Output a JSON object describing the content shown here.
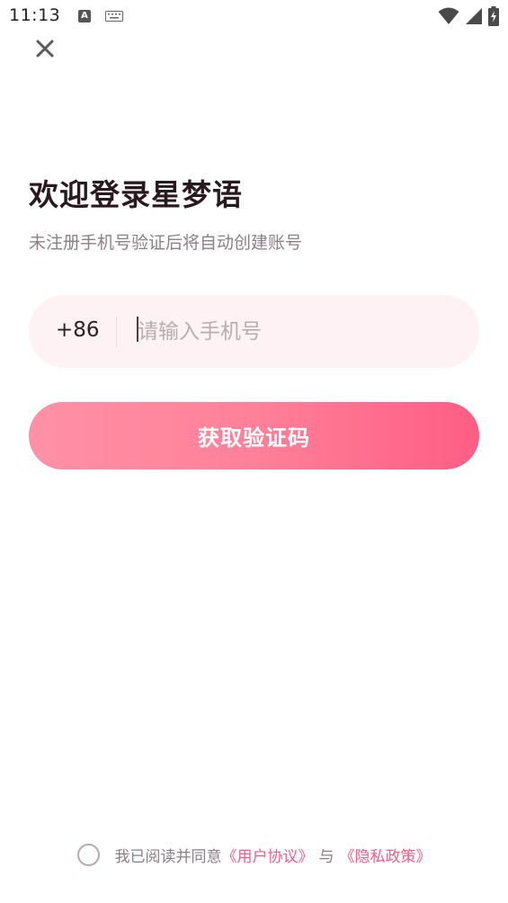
{
  "status_bar": {
    "time": "11:13",
    "input_icon": "A"
  },
  "login": {
    "title": "欢迎登录星梦语",
    "subtitle": "未注册手机号验证后将自动创建账号",
    "country_code": "+86",
    "phone_placeholder": "请输入手机号",
    "phone_value": "",
    "get_code_label": "获取验证码"
  },
  "agreement": {
    "prefix": "我已阅读并同意",
    "user_agreement": "《用户协议》",
    "and": "与",
    "privacy_policy": "《隐私政策》",
    "checked": false
  },
  "icons": {
    "close": "close-icon",
    "wifi": "wifi-icon",
    "signal": "signal-icon",
    "battery": "battery-charging-icon",
    "keyboard": "keyboard-icon"
  },
  "colors": {
    "accent": "#ff6b8e",
    "link": "#f0608a",
    "input_bg": "#fff2f4",
    "title": "#2a1a20",
    "subtitle": "#8c7f86"
  }
}
